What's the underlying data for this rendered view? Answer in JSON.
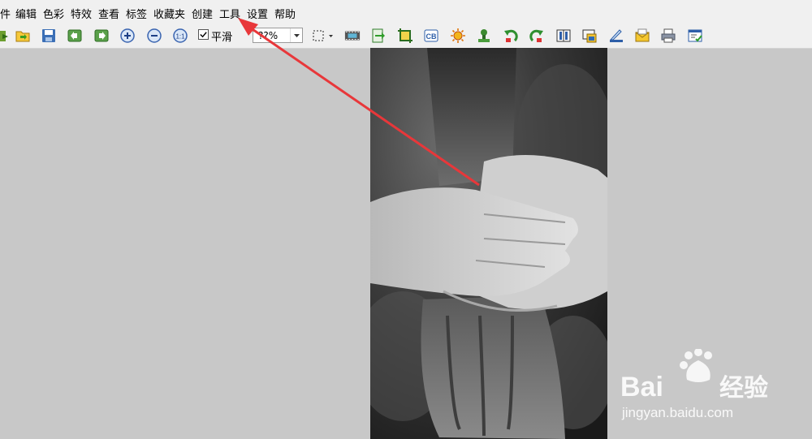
{
  "menubar": {
    "items": [
      {
        "label": "件"
      },
      {
        "label": "编辑"
      },
      {
        "label": "色彩"
      },
      {
        "label": "特效"
      },
      {
        "label": "查看"
      },
      {
        "label": "标签"
      },
      {
        "label": "收藏夹"
      },
      {
        "label": "创建"
      },
      {
        "label": "工具"
      },
      {
        "label": "设置"
      },
      {
        "label": "帮助"
      }
    ]
  },
  "toolbar": {
    "smooth_label": "平滑",
    "smooth_checked": true,
    "zoom_value": "??%",
    "icons": [
      "green-arrow-icon",
      "open-folder-icon",
      "save-icon",
      "previous-icon",
      "next-icon",
      "zoom-in-icon",
      "zoom-out-icon",
      "actual-size-icon",
      "selection-icon",
      "filmstrip-icon",
      "export-icon",
      "crop-icon",
      "cb-icon",
      "brightness-icon",
      "stamp-icon",
      "rotate-left-icon",
      "rotate-right-icon",
      "mirror-icon",
      "resize-icon",
      "scanner-icon",
      "email-icon",
      "print-icon",
      "properties-icon"
    ]
  },
  "image": {
    "subject": "black and white photo of stacked hands"
  },
  "watermark": {
    "brand": "Bai",
    "brand_cn": "经验",
    "url": "jingyan.baidu.com"
  },
  "colors": {
    "accent_arrow": "#e8373a",
    "menubar_bg": "#f0f0f0",
    "canvas_bg": "#c8c8c8"
  }
}
